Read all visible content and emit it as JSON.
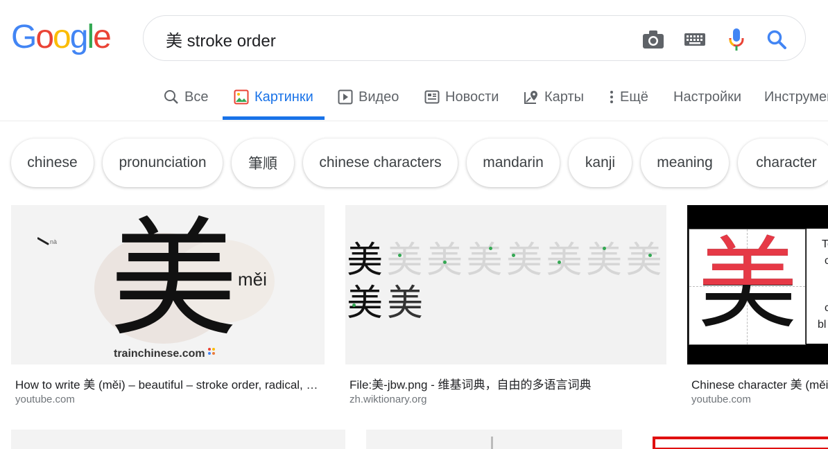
{
  "logo": {
    "text": "Google"
  },
  "search": {
    "value": "美 stroke order"
  },
  "search_icons": [
    "camera-icon",
    "keyboard-icon",
    "mic-icon",
    "search-icon"
  ],
  "tabs": [
    {
      "label": "Все",
      "icon": "search-icon"
    },
    {
      "label": "Картинки",
      "icon": "image-icon",
      "active": true
    },
    {
      "label": "Видео",
      "icon": "video-icon"
    },
    {
      "label": "Новости",
      "icon": "news-icon"
    },
    {
      "label": "Карты",
      "icon": "map-icon"
    },
    {
      "label": "Ещё",
      "icon": "more-icon"
    },
    {
      "label": "Настройки"
    },
    {
      "label": "Инструменты"
    }
  ],
  "chips": [
    "chinese",
    "pronunciation",
    "筆順",
    "chinese characters",
    "mandarin",
    "kanji",
    "meaning",
    "character"
  ],
  "results": [
    {
      "caption": "How to write 美 (měi) – beautiful – stroke order, radical, examples and stroke order animation",
      "source": "youtube.com",
      "image_text": {
        "char": "美",
        "pinyin": "měi",
        "small": "nà",
        "brand": "trainchinese.com"
      }
    },
    {
      "caption": "File:美-jbw.png - 维基词典，自由的多语言词典",
      "source": "zh.wiktionary.org",
      "image_text": {
        "char": "美"
      }
    },
    {
      "caption": "Chinese character 美 (měi)",
      "source": "youtube.com",
      "image_text": {
        "char": "美",
        "side_line1": "To",
        "side_line2": "c",
        "side_line3": "c",
        "side_line4": "bl"
      }
    }
  ],
  "colors": {
    "blue": "#4285F4",
    "red": "#EA4335",
    "yellow": "#FBBC05",
    "green": "#34A853",
    "accent": "#1a73e8",
    "muted": "#5f6368"
  }
}
